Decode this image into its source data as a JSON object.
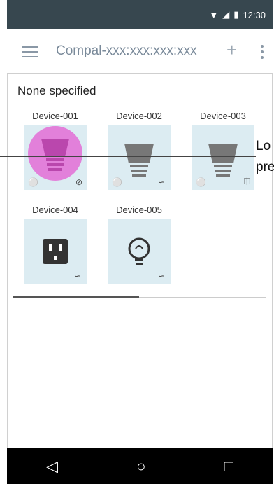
{
  "status_bar": {
    "time": "12:30"
  },
  "app_bar": {
    "title": "Compal-xxx:xxx:xxx:xxx",
    "add_icon": "plus-icon",
    "more_icon": "more-vertical-icon",
    "menu_icon": "hamburger-menu-icon"
  },
  "section": {
    "title": "None specified"
  },
  "devices": [
    {
      "label": "Device-001",
      "icon": "bulb-icon",
      "status_icon": "disconnected-icon"
    },
    {
      "label": "Device-002",
      "icon": "bulb-icon",
      "status_icon": "wifi-icon"
    },
    {
      "label": "Device-003",
      "icon": "bulb-icon",
      "status_icon": "bluetooth-icon"
    },
    {
      "label": "Device-004",
      "icon": "outlet-icon",
      "status_icon": "wifi-icon"
    },
    {
      "label": "Device-005",
      "icon": "bulb-outline-icon",
      "status_icon": "wifi-icon"
    }
  ],
  "annotation": {
    "line1": "Lo",
    "line2": "pre"
  },
  "progress": {
    "fraction": 0.5
  }
}
